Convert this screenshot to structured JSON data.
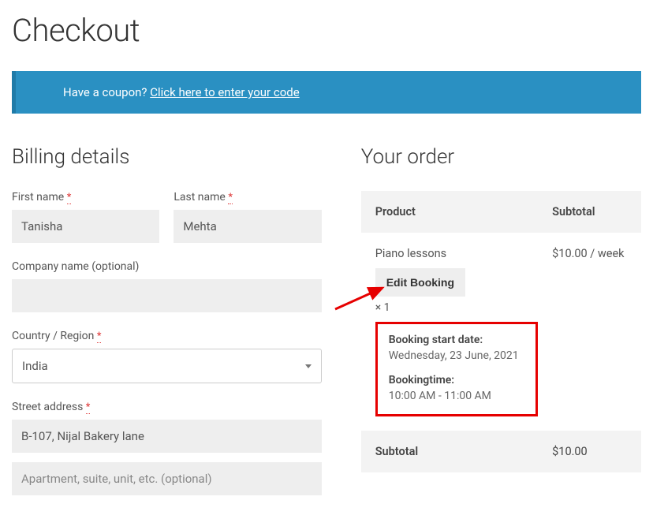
{
  "page": {
    "title": "Checkout"
  },
  "coupon": {
    "text": "Have a coupon? ",
    "link": "Click here to enter your code"
  },
  "billing": {
    "heading": "Billing details",
    "first_name": {
      "label": "First name",
      "value": "Tanisha"
    },
    "last_name": {
      "label": "Last name",
      "value": "Mehta"
    },
    "company": {
      "label": "Company name (optional)",
      "value": ""
    },
    "country": {
      "label": "Country / Region",
      "value": "India"
    },
    "street": {
      "label": "Street address",
      "value": "B-107, Nijal Bakery lane"
    },
    "apt": {
      "placeholder": "Apartment, suite, unit, etc. (optional)",
      "value": ""
    },
    "required_mark": "*"
  },
  "order": {
    "heading": "Your order",
    "col_product": "Product",
    "col_subtotal": "Subtotal",
    "item": {
      "name": "Piano lessons",
      "edit_label": "Edit Booking",
      "qty": "× 1",
      "price": "$10.00 / week",
      "booking_start_label": "Booking start date:",
      "booking_start_value": "Wednesday, 23 June, 2021",
      "booking_time_label": "Bookingtime:",
      "booking_time_value": "10:00 AM - 11:00 AM"
    },
    "subtotal_label": "Subtotal",
    "subtotal_value": "$10.00"
  }
}
